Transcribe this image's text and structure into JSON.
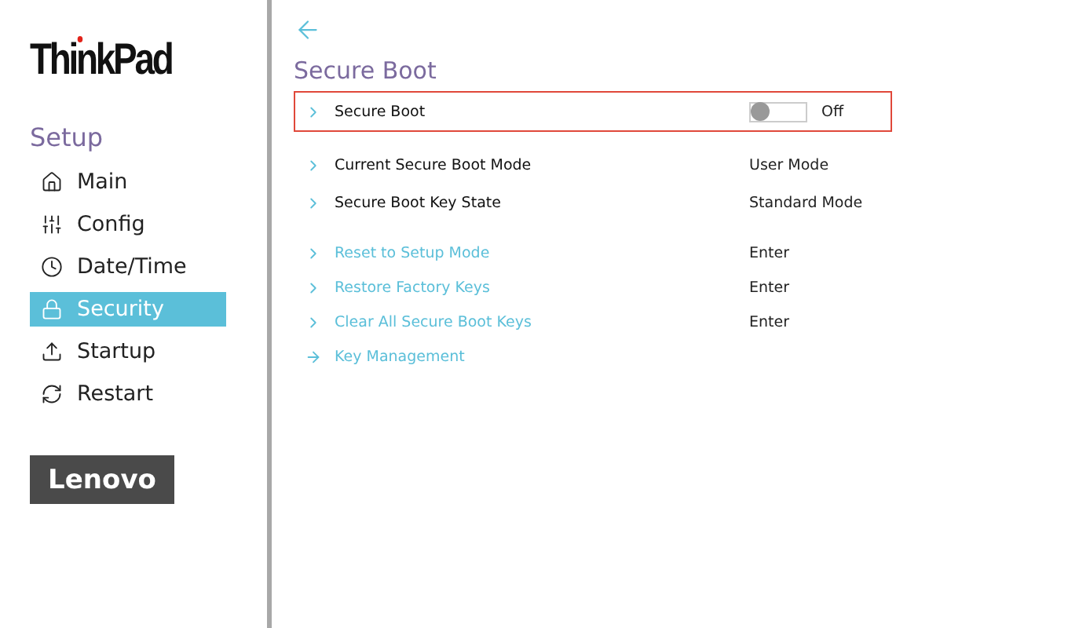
{
  "brand": {
    "product": "ThinkPad",
    "vendor": "Lenovo"
  },
  "sidebar": {
    "title": "Setup",
    "items": [
      {
        "label": "Main",
        "selected": false
      },
      {
        "label": "Config",
        "selected": false
      },
      {
        "label": "Date/Time",
        "selected": false
      },
      {
        "label": "Security",
        "selected": true
      },
      {
        "label": "Startup",
        "selected": false
      },
      {
        "label": "Restart",
        "selected": false
      }
    ]
  },
  "page": {
    "title": "Secure Boot",
    "rows": [
      {
        "kind": "toggle",
        "label": "Secure Boot",
        "on": false,
        "value": "Off",
        "focused": true
      },
      {
        "kind": "info",
        "label": "Current Secure Boot Mode",
        "value": "User Mode",
        "focused": false
      },
      {
        "kind": "info",
        "label": "Secure Boot Key State",
        "value": "Standard Mode",
        "focused": false
      },
      {
        "kind": "action",
        "label": "Reset to Setup Mode",
        "value": "Enter",
        "focused": false
      },
      {
        "kind": "action",
        "label": "Restore Factory Keys",
        "value": "Enter",
        "focused": false
      },
      {
        "kind": "action",
        "label": "Clear All Secure Boot Keys",
        "value": "Enter",
        "focused": false
      },
      {
        "kind": "link",
        "label": "Key Management",
        "focused": false
      }
    ]
  }
}
